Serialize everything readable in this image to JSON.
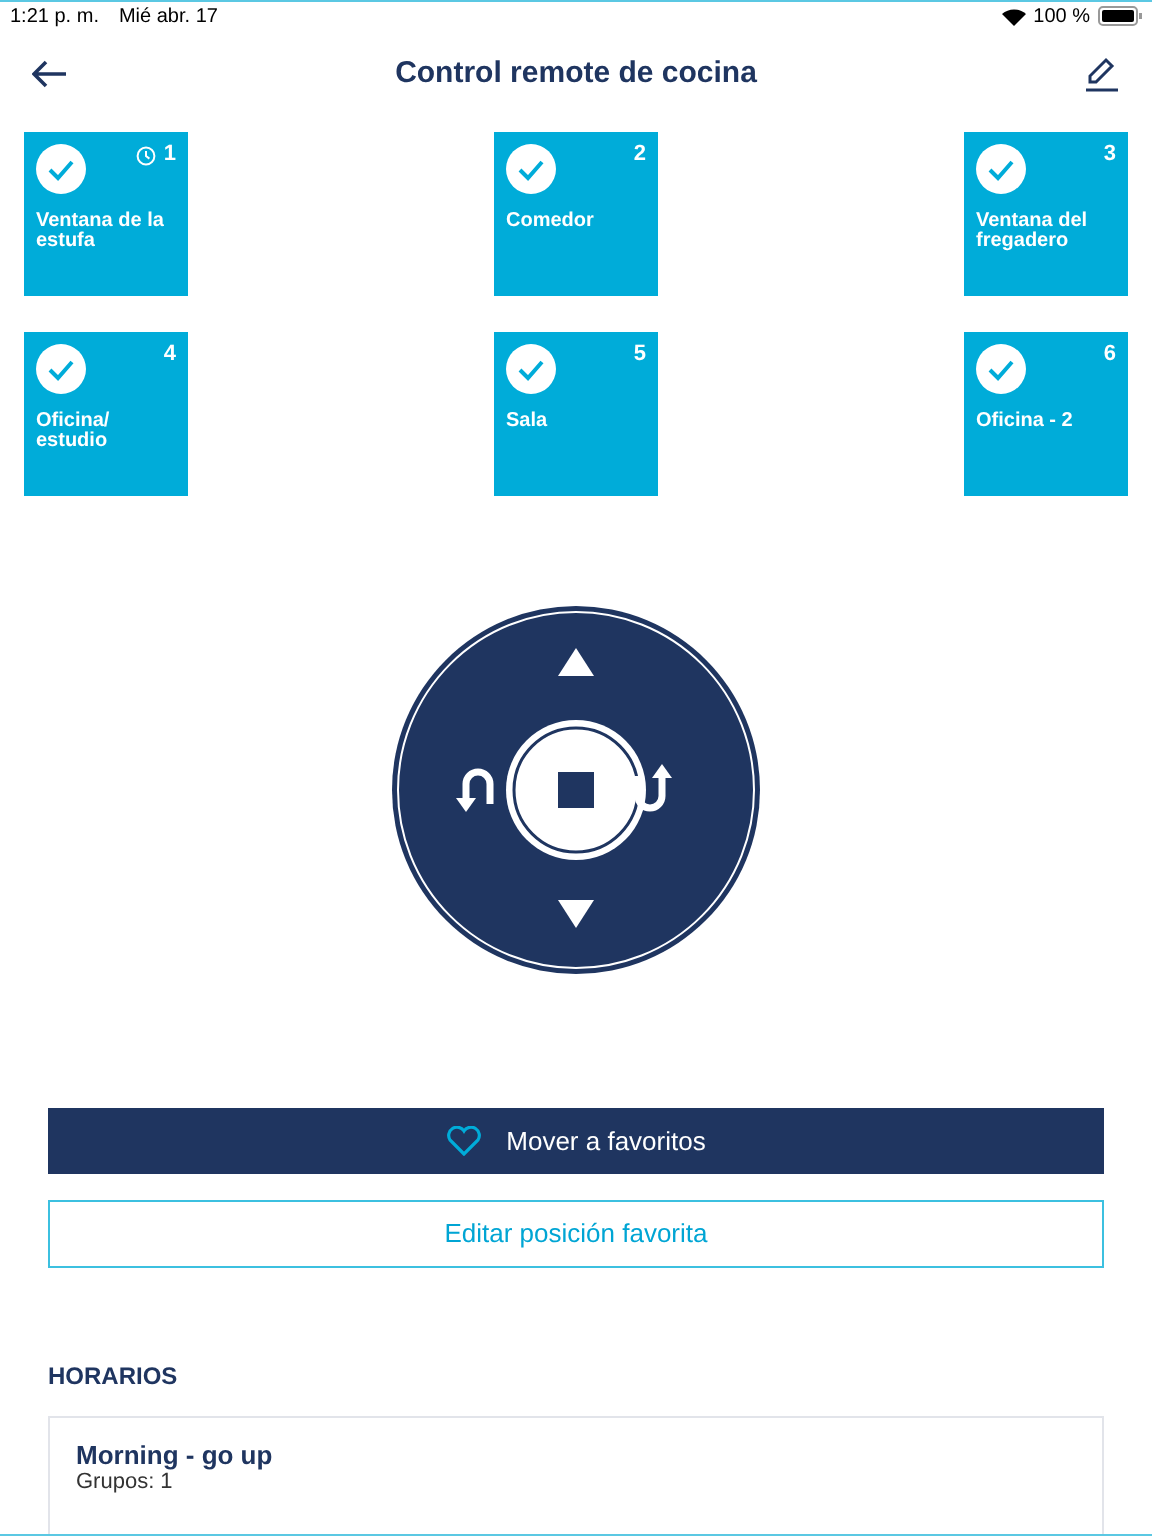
{
  "status_bar": {
    "time": "1:21 p. m.",
    "date": "Mié abr. 17",
    "battery": "100 %"
  },
  "header": {
    "title": "Control remote de cocina"
  },
  "groups": [
    {
      "number": "1",
      "name": "Ventana de la estufa",
      "selected": true,
      "scheduled": true
    },
    {
      "number": "2",
      "name": "Comedor",
      "selected": true,
      "scheduled": false
    },
    {
      "number": "3",
      "name": "Ventana del fregadero",
      "selected": true,
      "scheduled": false
    },
    {
      "number": "4",
      "name": "Oficina/ estudio",
      "selected": true,
      "scheduled": false
    },
    {
      "number": "5",
      "name": "Sala",
      "selected": true,
      "scheduled": false
    },
    {
      "number": "6",
      "name": "Oficina - 2",
      "selected": true,
      "scheduled": false
    }
  ],
  "buttons": {
    "favorite": "Mover a favoritos",
    "edit_favorite": "Editar posición favorita"
  },
  "schedules": {
    "heading": "HORARIOS",
    "items": [
      {
        "name": "Morning - go up",
        "groups": "Grupos: 1"
      }
    ]
  }
}
